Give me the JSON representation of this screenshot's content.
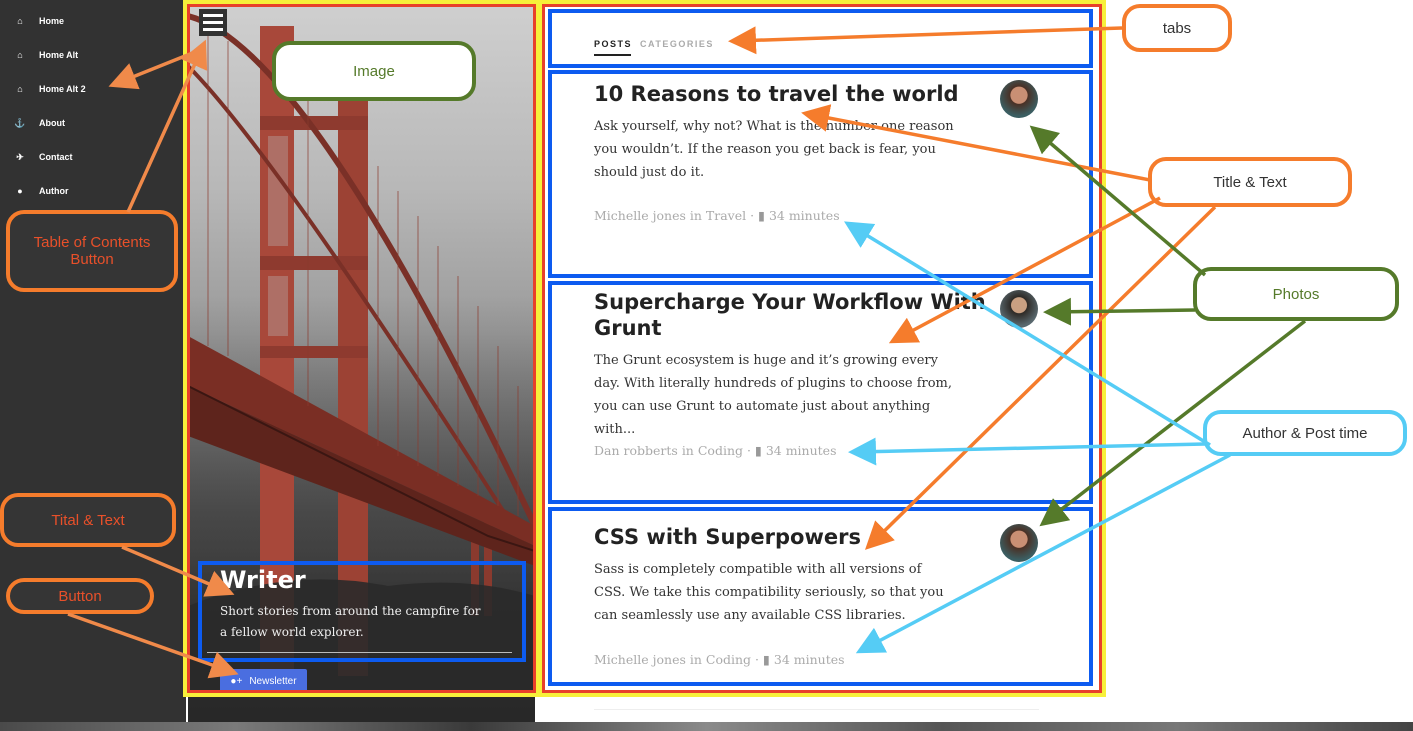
{
  "sidebar": {
    "items": [
      {
        "label": "Home",
        "icon": "home-icon"
      },
      {
        "label": "Home Alt",
        "icon": "home-icon"
      },
      {
        "label": "Home Alt 2",
        "icon": "home-icon"
      },
      {
        "label": "About",
        "icon": "anchor-icon"
      },
      {
        "label": "Contact",
        "icon": "plane-icon"
      },
      {
        "label": "Author",
        "icon": "user-icon"
      }
    ]
  },
  "hero": {
    "title": "Writer",
    "text": "Short stories from around the campfire for a fellow world explorer.",
    "button_label": "Newsletter"
  },
  "tabs": [
    {
      "label": "POSTS",
      "active": true
    },
    {
      "label": "CATEGORIES",
      "active": false
    }
  ],
  "posts": [
    {
      "title": "10 Reasons to travel the world",
      "text": "Ask yourself, why not? What is the number one reason you wouldn’t. If the reason you get back is fear, you should just do it.",
      "author": "Michelle jones",
      "in": "in",
      "category": "Travel",
      "read_time": "34 minutes"
    },
    {
      "title": "Supercharge Your Workflow With Grunt",
      "text": "The Grunt ecosystem is huge and it’s growing every day. With literally hundreds of plugins to choose from, you can use Grunt to automate just about anything with...",
      "author": "Dan robberts",
      "in": "in",
      "category": "Coding",
      "read_time": "34 minutes"
    },
    {
      "title": "CSS with Superpowers",
      "text": "Sass is completely compatible with all versions of CSS. We take this compatibility seriously, so that you can seamlessly use any available CSS libraries.",
      "author": "Michelle jones",
      "in": "in",
      "category": "Coding",
      "read_time": "34 minutes"
    }
  ],
  "annotations": {
    "tabs": "tabs",
    "image": "Image",
    "title_text": "Title & Text",
    "photos": "Photos",
    "author_post_time": "Author & Post time",
    "toc_button": "Table of Contents Button",
    "tital_text": "Tital & Text",
    "button": "Button"
  },
  "colors": {
    "sidebar_bg": "#323232",
    "annotation_blue": "#0d5bf0",
    "annotation_red": "#e8402a",
    "annotation_yellow": "#f7f03a",
    "annotation_orange": "#f57c2c",
    "annotation_green": "#557a2a",
    "annotation_cyan": "#55ccf5",
    "newsletter_button": "#4a6ee0"
  }
}
